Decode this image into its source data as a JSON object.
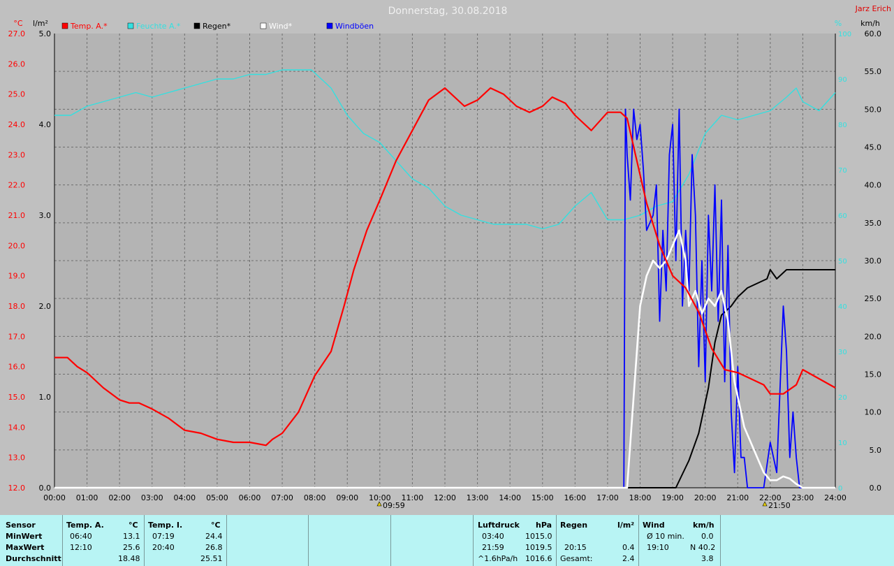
{
  "header": {
    "title": "Donnerstag, 30.08.2018",
    "author": "Jarz Erich"
  },
  "colors": {
    "temp": "#ff0000",
    "humidity": "#33e0e0",
    "rain": "#000000",
    "wind": "#ffffff",
    "gust": "#0000ff",
    "background": "#b4b4b4",
    "stats_bg": "#b8f4f4"
  },
  "chart_data": {
    "type": "line",
    "x_unit": "hours",
    "x_ticks": [
      "00:00",
      "01:00",
      "02:00",
      "03:00",
      "04:00",
      "05:00",
      "06:00",
      "07:00",
      "08:00",
      "09:00",
      "10:00",
      "11:00",
      "12:00",
      "13:00",
      "14:00",
      "15:00",
      "16:00",
      "17:00",
      "18:00",
      "19:00",
      "20:00",
      "21:00",
      "22:00",
      "23:00",
      "24:00"
    ],
    "axes": {
      "temp": {
        "unit": "°C",
        "range": [
          12.0,
          27.0
        ],
        "ticks": [
          "12.0",
          "13.0",
          "14.0",
          "15.0",
          "16.0",
          "17.0",
          "18.0",
          "19.0",
          "20.0",
          "21.0",
          "22.0",
          "23.0",
          "24.0",
          "25.0",
          "26.0",
          "27.0"
        ]
      },
      "rain": {
        "unit": "l/m²",
        "range": [
          0.0,
          5.0
        ],
        "ticks": [
          "0.0",
          "1.0",
          "2.0",
          "3.0",
          "4.0",
          "5.0"
        ]
      },
      "humidity": {
        "unit": "%",
        "range": [
          0,
          100
        ],
        "ticks": [
          "0",
          "10",
          "20",
          "30",
          "40",
          "50",
          "60",
          "70",
          "80",
          "90",
          "100"
        ]
      },
      "wind": {
        "unit": "km/h",
        "range": [
          0,
          60
        ],
        "ticks": [
          "0.0",
          "5.0",
          "10.0",
          "15.0",
          "20.0",
          "25.0",
          "30.0",
          "35.0",
          "40.0",
          "45.0",
          "50.0",
          "55.0",
          "60.0"
        ]
      }
    },
    "grid": true,
    "legend": [
      {
        "label": "Temp. A.*",
        "series": "temp"
      },
      {
        "label": "Feuchte A.*",
        "series": "humidity"
      },
      {
        "label": "Regen*",
        "series": "rain"
      },
      {
        "label": "Wind*",
        "series": "wind"
      },
      {
        "label": "Windböen",
        "series": "gust"
      }
    ],
    "series": [
      {
        "name": "Temp. A.*",
        "key": "temp",
        "axis": "temp",
        "x": [
          0,
          0.4,
          0.7,
          1,
          1.5,
          2,
          2.3,
          2.6,
          3,
          3.5,
          4,
          4.5,
          5,
          5.5,
          6,
          6.5,
          6.7,
          7,
          7.5,
          8,
          8.5,
          8.9,
          9.2,
          9.6,
          10,
          10.5,
          11,
          11.5,
          12,
          12.2,
          12.6,
          13,
          13.4,
          13.8,
          14.2,
          14.6,
          15,
          15.3,
          15.7,
          16,
          16.5,
          17,
          17.4,
          17.6,
          17.9,
          18.2,
          18.6,
          19,
          19.4,
          19.8,
          20.2,
          20.6,
          21,
          21.4,
          21.8,
          22,
          22.4,
          22.8,
          23,
          23.5,
          24
        ],
        "y": [
          16.3,
          16.3,
          16.0,
          15.8,
          15.3,
          14.9,
          14.8,
          14.8,
          14.6,
          14.3,
          13.9,
          13.8,
          13.6,
          13.5,
          13.5,
          13.4,
          13.6,
          13.8,
          14.5,
          15.7,
          16.5,
          18.0,
          19.2,
          20.5,
          21.5,
          22.8,
          23.8,
          24.8,
          25.2,
          25.0,
          24.6,
          24.8,
          25.2,
          25.0,
          24.6,
          24.4,
          24.6,
          24.9,
          24.7,
          24.3,
          23.8,
          24.4,
          24.4,
          24.2,
          22.8,
          21.4,
          20.0,
          19.0,
          18.6,
          17.8,
          16.6,
          15.9,
          15.8,
          15.6,
          15.4,
          15.1,
          15.1,
          15.4,
          15.9,
          15.6,
          15.3
        ]
      },
      {
        "name": "Feuchte A.*",
        "key": "humidity",
        "axis": "humidity",
        "x": [
          0,
          0.5,
          1,
          1.5,
          2,
          2.5,
          3,
          3.5,
          4,
          4.5,
          5,
          5.5,
          6,
          6.5,
          7,
          7.5,
          7.9,
          8.5,
          9,
          9.5,
          10,
          10.5,
          11,
          11.5,
          12,
          12.5,
          13,
          13.5,
          14,
          14.5,
          15,
          15.5,
          16,
          16.5,
          17,
          17.5,
          18,
          18.5,
          19,
          19.5,
          20,
          20.5,
          21,
          21.5,
          22,
          22.5,
          22.8,
          23,
          23.5,
          24
        ],
        "y": [
          82,
          82,
          84,
          85,
          86,
          87,
          86,
          87,
          88,
          89,
          90,
          90,
          91,
          91,
          92,
          92,
          92,
          88,
          82,
          78,
          76,
          72,
          68,
          66,
          62,
          60,
          59,
          58,
          58,
          58,
          57,
          58,
          62,
          65,
          59,
          59,
          60,
          62,
          63,
          69,
          78,
          82,
          81,
          82,
          83,
          86,
          88,
          85,
          83,
          87
        ]
      },
      {
        "name": "Regen*",
        "key": "rain",
        "axis": "rain",
        "x": [
          0,
          19.1,
          19.5,
          19.8,
          20.1,
          20.3,
          20.5,
          20.8,
          21,
          21.3,
          21.6,
          21.9,
          22,
          22.2,
          22.5,
          23,
          24
        ],
        "y": [
          0,
          0,
          0.3,
          0.6,
          1.1,
          1.6,
          1.9,
          2.0,
          2.1,
          2.2,
          2.25,
          2.3,
          2.4,
          2.3,
          2.4,
          2.4,
          2.4
        ]
      },
      {
        "name": "Wind*",
        "key": "wind",
        "axis": "wind",
        "x": [
          0,
          17.6,
          17.65,
          17.8,
          18,
          18.2,
          18.4,
          18.6,
          18.8,
          19,
          19.2,
          19.4,
          19.5,
          19.7,
          19.9,
          20.1,
          20.3,
          20.5,
          20.7,
          20.9,
          21,
          21.2,
          21.4,
          21.6,
          21.8,
          22,
          22.2,
          22.4,
          22.6,
          22.8,
          23,
          24
        ],
        "y": [
          0,
          0,
          3,
          12,
          24,
          28,
          30,
          29,
          30,
          32,
          34,
          30,
          24,
          26,
          23,
          25,
          24,
          26,
          22,
          14,
          12,
          8,
          6,
          4,
          2,
          1,
          1,
          1.5,
          1.2,
          0.5,
          0,
          0
        ]
      },
      {
        "name": "Windböen",
        "key": "gust",
        "axis": "gust",
        "x": [
          0,
          17.5,
          17.55,
          17.6,
          17.7,
          17.8,
          17.9,
          18,
          18.1,
          18.2,
          18.4,
          18.5,
          18.6,
          18.7,
          18.8,
          18.9,
          19,
          19.1,
          19.2,
          19.3,
          19.4,
          19.5,
          19.6,
          19.7,
          19.8,
          19.9,
          20,
          20.1,
          20.2,
          20.3,
          20.4,
          20.5,
          20.6,
          20.7,
          20.8,
          20.9,
          21,
          21.1,
          21.2,
          21.3,
          21.4,
          21.6,
          21.8,
          22,
          22.2,
          22.4,
          22.5,
          22.6,
          22.7,
          22.8,
          22.9,
          23,
          24
        ],
        "y": [
          0,
          0,
          50,
          44,
          38,
          50,
          46,
          48,
          42,
          34,
          36,
          40,
          22,
          34,
          26,
          44,
          48,
          30,
          50,
          24,
          34,
          26,
          44,
          36,
          16,
          30,
          14,
          36,
          26,
          40,
          22,
          38,
          14,
          32,
          10,
          2,
          16,
          4,
          4,
          0,
          0,
          0,
          0,
          6,
          2,
          24,
          18,
          4,
          10,
          4,
          0,
          0,
          0
        ]
      }
    ],
    "events": [
      {
        "label": "09:59",
        "x": 9.983
      },
      {
        "label": "21:50",
        "x": 21.833
      }
    ]
  },
  "stats": {
    "sensor": {
      "title": "Sensor",
      "rows": [
        "MinWert",
        "MaxWert",
        "Durchschnitt"
      ]
    },
    "temp_a": {
      "title": "Temp. A.",
      "unit": "°C",
      "min_time": "06:40",
      "min_val": "13.1",
      "max_time": "12:10",
      "max_val": "25.6",
      "avg": "18.48"
    },
    "temp_i": {
      "title": "Temp. I.",
      "unit": "°C",
      "min_time": "07:19",
      "min_val": "24.4",
      "max_time": "20:40",
      "max_val": "26.8",
      "avg": "25.51"
    },
    "pressure": {
      "title": "Luftdruck",
      "unit": "hPa",
      "min_time": "03:40",
      "min_val": "1015.0",
      "max_time": "21:59",
      "max_val": "1019.5",
      "trend_label": "^1.6hPa/h",
      "trend_val": "1016.6"
    },
    "rain": {
      "title": "Regen",
      "unit": "l/m²",
      "max_time": "20:15",
      "max_val": "0.4",
      "total_label": "Gesamt:",
      "total_val": "2.4"
    },
    "wind": {
      "title": "Wind",
      "unit": "km/h",
      "avg10_label": "Ø 10 min.",
      "avg10_val": "0.0",
      "max_time": "19:10",
      "max_val": "N 40.2",
      "avg_val": "3.8"
    }
  }
}
